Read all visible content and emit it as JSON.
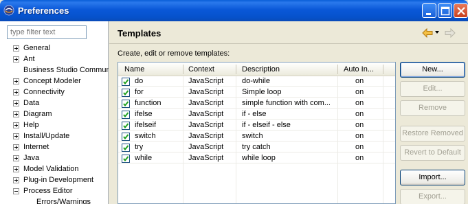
{
  "window": {
    "title": "Preferences",
    "icon": "eclipse-icon",
    "controls": [
      "minimize",
      "maximize",
      "close"
    ]
  },
  "sidebar": {
    "filter_placeholder": "type filter text",
    "items": [
      {
        "label": "General",
        "expander": "plus"
      },
      {
        "label": "Ant",
        "expander": "plus"
      },
      {
        "label": "Business Studio Communi",
        "expander": "none"
      },
      {
        "label": "Concept Modeler",
        "expander": "plus"
      },
      {
        "label": "Connectivity",
        "expander": "plus"
      },
      {
        "label": "Data",
        "expander": "plus"
      },
      {
        "label": "Diagram",
        "expander": "plus"
      },
      {
        "label": "Help",
        "expander": "plus"
      },
      {
        "label": "Install/Update",
        "expander": "plus"
      },
      {
        "label": "Internet",
        "expander": "plus"
      },
      {
        "label": "Java",
        "expander": "plus"
      },
      {
        "label": "Model Validation",
        "expander": "plus"
      },
      {
        "label": "Plug-in Development",
        "expander": "plus"
      },
      {
        "label": "Process Editor",
        "expander": "minus"
      },
      {
        "label": "Errors/Warnings",
        "expander": "child"
      }
    ]
  },
  "main": {
    "title": "Templates",
    "description": "Create, edit or remove templates:",
    "table": {
      "columns": [
        "Name",
        "Context",
        "Description",
        "Auto In..."
      ],
      "rows": [
        {
          "checked": true,
          "name": "do",
          "context": "JavaScript",
          "description": "do-while",
          "auto": "on"
        },
        {
          "checked": true,
          "name": "for",
          "context": "JavaScript",
          "description": "Simple loop",
          "auto": "on"
        },
        {
          "checked": true,
          "name": "function",
          "context": "JavaScript",
          "description": "simple function with com...",
          "auto": "on"
        },
        {
          "checked": true,
          "name": "ifelse",
          "context": "JavaScript",
          "description": "if - else",
          "auto": "on"
        },
        {
          "checked": true,
          "name": "ifelseif",
          "context": "JavaScript",
          "description": "if - elseif - else",
          "auto": "on"
        },
        {
          "checked": true,
          "name": "switch",
          "context": "JavaScript",
          "description": "switch",
          "auto": "on"
        },
        {
          "checked": true,
          "name": "try",
          "context": "JavaScript",
          "description": "try catch",
          "auto": "on"
        },
        {
          "checked": true,
          "name": "while",
          "context": "JavaScript",
          "description": "while loop",
          "auto": "on"
        }
      ]
    },
    "buttons": [
      {
        "label": "New...",
        "enabled": true
      },
      {
        "label": "Edit...",
        "enabled": false
      },
      {
        "label": "Remove",
        "enabled": false
      },
      {
        "label": "Restore Removed",
        "enabled": false
      },
      {
        "label": "Revert to Default",
        "enabled": false
      },
      {
        "label": "Import...",
        "enabled": true
      },
      {
        "label": "Export...",
        "enabled": false
      }
    ]
  },
  "colors": {
    "titlebar": "#0a58d8",
    "check": "#21a121",
    "nav_back": "#e8a020"
  }
}
